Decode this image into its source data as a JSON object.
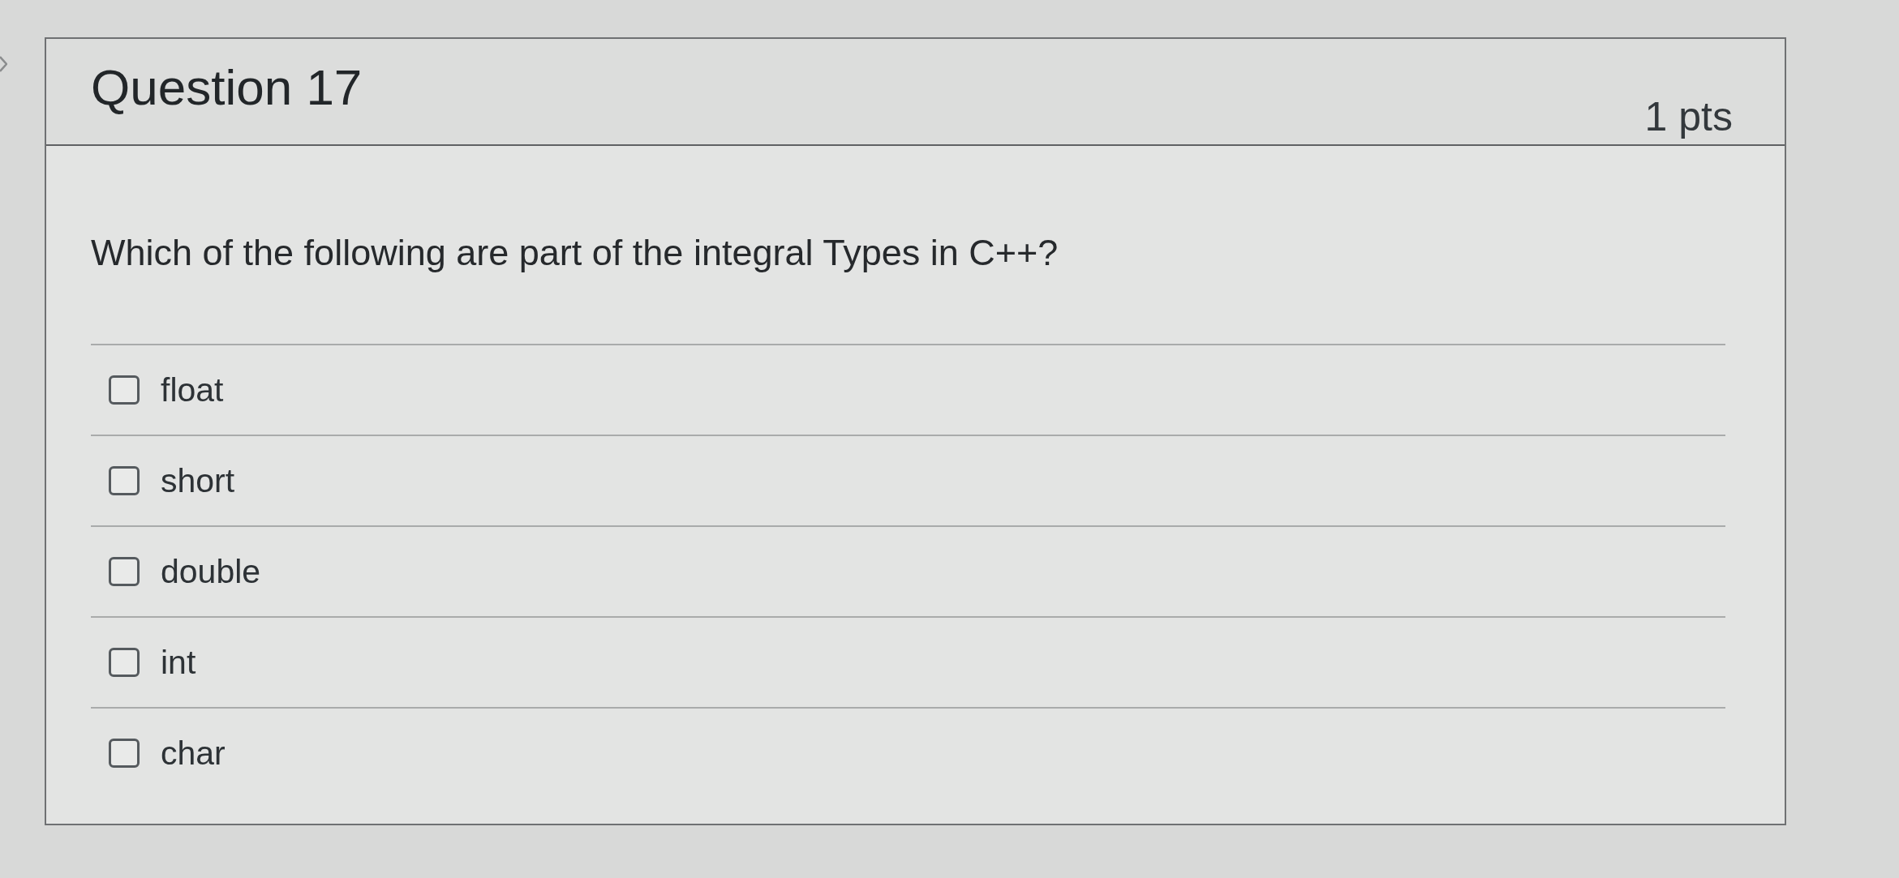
{
  "question": {
    "title": "Question 17",
    "points": "1 pts",
    "text": "Which of the following are part of the integral Types in C++?"
  },
  "options": [
    {
      "label": "float",
      "checked": false
    },
    {
      "label": "short",
      "checked": false
    },
    {
      "label": "double",
      "checked": false
    },
    {
      "label": "int",
      "checked": false
    },
    {
      "label": "char",
      "checked": false
    }
  ]
}
